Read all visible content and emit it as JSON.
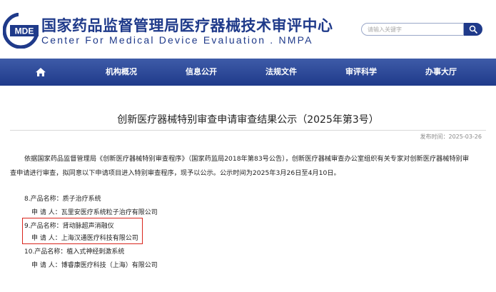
{
  "header": {
    "logo_text": "MDE",
    "title_cn": "国家药品监督管理局医疗器械技术审评中心",
    "title_en": "Center For Medical Device Evaluation . NMPA",
    "search": {
      "placeholder": "请输入关键字"
    }
  },
  "nav": {
    "items": [
      {
        "label": "机构概况"
      },
      {
        "label": "信息公开"
      },
      {
        "label": "法规文件"
      },
      {
        "label": "审评科学"
      },
      {
        "label": "办事大厅"
      }
    ]
  },
  "article": {
    "title": "创新医疗器械特别审查申请审查结果公示（2025年第3号）",
    "publish_time": "发布时间：2025-03-26",
    "paragraph_lines": [
      "依据国家药品监督管理局《创新医疗器械特别审查程序》（国家药监局2018年第83号公告），创新医疗器械审查办公室组织有关专家对创新医疗器械特别审",
      "查申请进行审查，拟同意以下申请项目进入特别审查程序，现予以公示。公示时间为2025年3月26日至4月10日。"
    ],
    "entries": [
      {
        "product": "8.产品名称：质子治疗系统",
        "applicant": "申 请 人：瓦里安医疗系统粒子治疗有限公司"
      },
      {
        "product": "9.产品名称：肾动脉超声消融仪",
        "applicant": "申 请 人：上海汉通医疗科技有限公司"
      },
      {
        "product": "10.产品名称：植入式神经刺激系统",
        "applicant": "申 请 人：博睿康医疗科技（上海）有限公司"
      }
    ]
  },
  "colors": {
    "brand": "#1f3a8a",
    "nav_bg": "#2c4a9a",
    "highlight_border": "#d9251d"
  }
}
